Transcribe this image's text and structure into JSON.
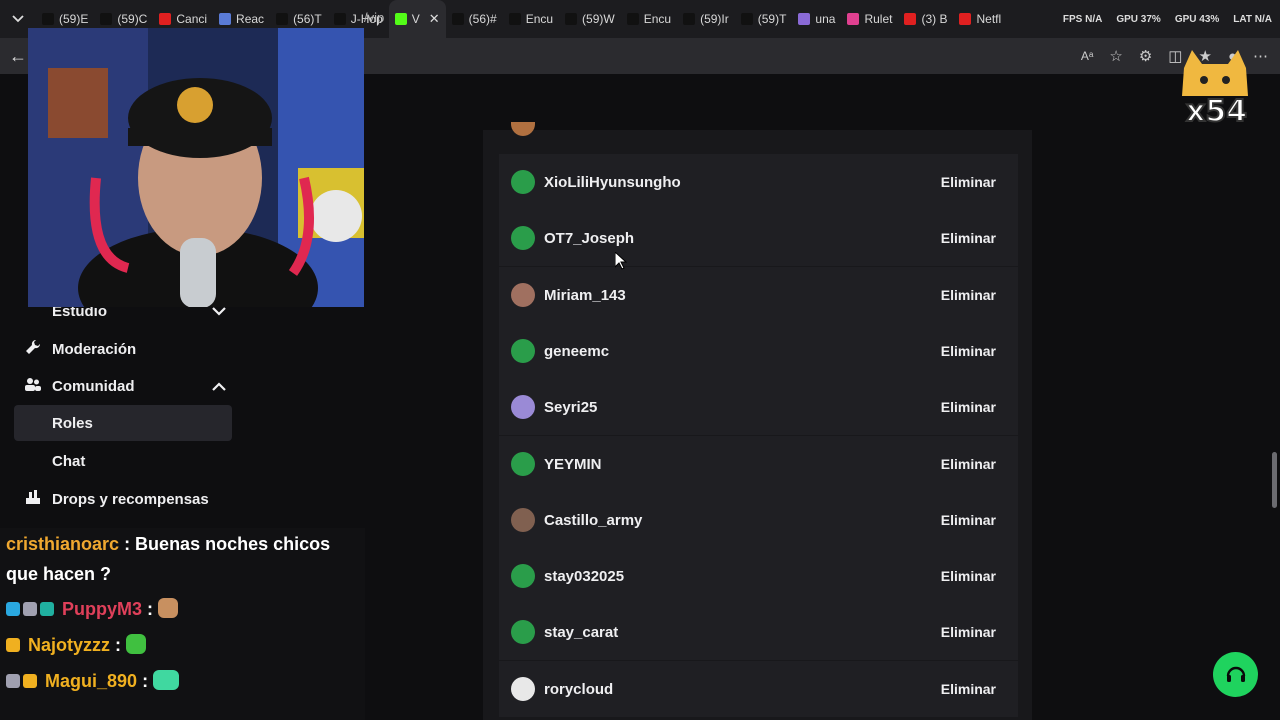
{
  "browser": {
    "tabs": [
      {
        "label": "(59)E",
        "color": "#000000"
      },
      {
        "label": "(59)C",
        "color": "#000000"
      },
      {
        "label": "Canci",
        "color": "#e02020"
      },
      {
        "label": "Reac",
        "color": "#5a7bd6"
      },
      {
        "label": "(56)T",
        "color": "#000000"
      },
      {
        "label": "J-Hop",
        "color": "#000000"
      },
      {
        "label": "V",
        "color": "#53fc18",
        "active": true
      },
      {
        "label": "(56)#",
        "color": "#000000"
      },
      {
        "label": "Encu",
        "color": "#000000"
      },
      {
        "label": "(59)W",
        "color": "#000000"
      },
      {
        "label": "Encu",
        "color": "#000000"
      },
      {
        "label": "(59)Ir",
        "color": "#000000"
      },
      {
        "label": "(59)T",
        "color": "#000000"
      },
      {
        "label": "una",
        "color": "#8a6ad6"
      },
      {
        "label": "Rulet",
        "color": "#e04090"
      },
      {
        "label": "(3) B",
        "color": "#e02020"
      },
      {
        "label": "Netfl",
        "color": "#e02020"
      }
    ],
    "stats": {
      "fps": "FPS N/A",
      "gpu1": "GPU 37%",
      "gpu2": "GPU 43%",
      "lat": "LAT N/A"
    },
    "url": "/vip"
  },
  "sidebar": {
    "items": [
      {
        "label": "Estudio",
        "icon": "studio-icon",
        "expanded": false
      },
      {
        "label": "Moderación",
        "icon": "wrench-icon"
      },
      {
        "label": "Comunidad",
        "icon": "community-icon",
        "expanded": true
      },
      {
        "label": "Roles",
        "selected": true
      },
      {
        "label": "Chat"
      },
      {
        "label": "Drops y recompensas",
        "icon": "drops-icon"
      }
    ]
  },
  "chat": {
    "messages": [
      {
        "user": "cristhianoarc",
        "color": "#f0a830",
        "text": ": Buenas noches chicos",
        "cont": "que hacen ?"
      },
      {
        "user": "PuppyM3",
        "color": "#e0405a",
        "text": ":"
      },
      {
        "user": "Najotyzzz",
        "color": "#f0b020",
        "text": ":"
      },
      {
        "user": "Magui_890",
        "color": "#f0b020",
        "text": ":"
      }
    ]
  },
  "vip_list": {
    "button_label": "Eliminar",
    "users": [
      {
        "name": "XioLiliHyunsungho",
        "avatar": "#2a9d4a"
      },
      {
        "name": "OT7_Joseph",
        "avatar": "#2a9d4a"
      },
      {
        "name": "Miriam_143",
        "avatar": "#a07060"
      },
      {
        "name": "geneemc",
        "avatar": "#2a9d4a"
      },
      {
        "name": "Seyri25",
        "avatar": "#9a8ad6"
      },
      {
        "name": "YEYMIN",
        "avatar": "#2a9d4a"
      },
      {
        "name": "Castillo_army",
        "avatar": "#806050"
      },
      {
        "name": "stay032025",
        "avatar": "#2a9d4a"
      },
      {
        "name": "stay_carat",
        "avatar": "#2a9d4a"
      },
      {
        "name": "rorycloud",
        "avatar": "#e8e8e8"
      }
    ]
  },
  "overlay": {
    "cat_label": "x54"
  },
  "colors": {
    "accent_green": "#1fd35e",
    "kick_green": "#53fc18"
  }
}
